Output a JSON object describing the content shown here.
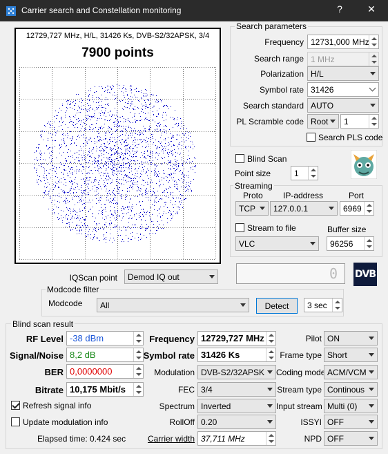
{
  "window": {
    "title": "Carrier search and Constellation monitoring",
    "help_glyph": "?",
    "close_glyph": "✕"
  },
  "constellation": {
    "info": "12729,727 MHz, H/L, 31426 Ks, DVB-S2/32APSK, 3/4",
    "points_label": "7900 points",
    "point_color": "#0000c8"
  },
  "search_params": {
    "group_label": "Search parameters",
    "frequency_label": "Frequency",
    "frequency_value": "12731,000 MHz",
    "range_label": "Search range",
    "range_value": "1 MHz",
    "polarization_label": "Polarization",
    "polarization_value": "H/L",
    "symbol_rate_label": "Symbol rate",
    "symbol_rate_value": "31426",
    "standard_label": "Search standard",
    "standard_value": "AUTO",
    "pls_label": "PL Scramble code",
    "pls_mode": "Root",
    "pls_value": "1",
    "search_pls_label": "Search PLS code"
  },
  "blind_scan": {
    "label": "Blind Scan",
    "checked": false
  },
  "point_size": {
    "label": "Point size",
    "value": "1"
  },
  "streaming": {
    "group_label": "Streaming",
    "proto_label": "Proto",
    "ip_label": "IP-address",
    "port_label": "Port",
    "proto_value": "TCP",
    "ip_value": "127.0.0.1",
    "port_value": "6969",
    "stream_to_file_label": "Stream to file",
    "buffer_label": "Buffer size",
    "player_value": "VLC",
    "buffer_value": "96256"
  },
  "iq": {
    "label": "IQScan point",
    "value": "Demod IQ out"
  },
  "lcd": {
    "value": "0"
  },
  "dvb_logo": {
    "text": "DVB"
  },
  "modcode": {
    "group_label": "Modcode filter",
    "label": "Modcode",
    "value": "All",
    "detect_label": "Detect",
    "timeout_value": "3 sec"
  },
  "result": {
    "group_label": "Blind scan result",
    "rf_level_label": "RF Level",
    "rf_level_value": "-38 dBm",
    "snr_label": "Signal/Noise",
    "snr_value": "8,2 dB",
    "ber_label": "BER",
    "ber_value": "0,0000000",
    "bitrate_label": "Bitrate",
    "bitrate_value": "10,175 Mbit/s",
    "frequency_label": "Frequency",
    "frequency_value": "12729,727 MHz",
    "symbol_rate_label": "Symbol rate",
    "symbol_rate_value": "31426 Ks",
    "modulation_label": "Modulation",
    "modulation_value": "DVB-S2/32APSK",
    "fec_label": "FEC",
    "fec_value": "3/4",
    "spectrum_label": "Spectrum",
    "spectrum_value": "Inverted",
    "rolloff_label": "RollOff",
    "rolloff_value": "0.20",
    "carrier_width_label": "Carrier width",
    "carrier_width_value": "37,711 MHz",
    "pilot_label": "Pilot",
    "pilot_value": "ON",
    "frame_type_label": "Frame type",
    "frame_type_value": "Short",
    "coding_mode_label": "Coding mode",
    "coding_mode_value": "ACM/VCM",
    "stream_type_label": "Stream type",
    "stream_type_value": "Continous",
    "input_stream_label": "Input stream",
    "input_stream_value": "Multi (0)",
    "issyi_label": "ISSYI",
    "issyi_value": "OFF",
    "npd_label": "NPD",
    "npd_value": "OFF",
    "refresh_label": "Refresh signal info",
    "refresh_checked": true,
    "update_label": "Update modulation info",
    "update_checked": false,
    "elapsed": "Elapsed time: 0.424 sec"
  },
  "colors": {
    "rf_level": "#1a55d8",
    "snr": "#1a8a1a",
    "ber": "#e00000",
    "accent": "#0078d7"
  }
}
